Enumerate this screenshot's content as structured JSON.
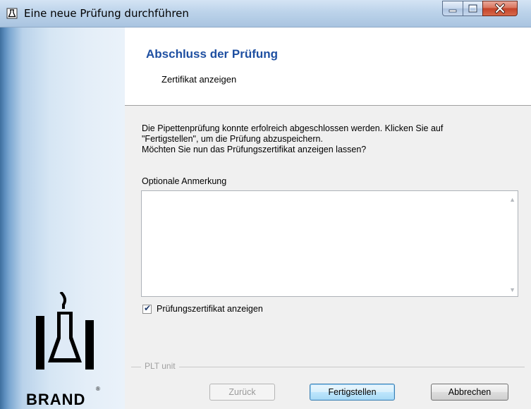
{
  "window": {
    "title": "Eine neue Prüfung durchführen"
  },
  "header": {
    "title": "Abschluss der Prüfung",
    "subtitle": "Zertifikat anzeigen"
  },
  "content": {
    "description_lines": [
      "Die Pipettenprüfung konnte erfolreich abgeschlossen werden. Klicken Sie auf",
      "\"Fertigstellen\", um die Prüfung abzuspeichern.",
      "Möchten Sie nun das Prüfungszertifikat anzeigen lassen?"
    ],
    "note_label": "Optionale Anmerkung",
    "note_value": "",
    "certificate_checkbox_label": "Prüfungszertifikat anzeigen",
    "certificate_checked": true
  },
  "footer": {
    "group_label": "PLT unit",
    "back_label": "Zurück",
    "finish_label": "Fertigstellen",
    "cancel_label": "Abbrechen"
  },
  "branding": {
    "logo_text": "BRAND",
    "registered_mark": "®"
  },
  "icons": {
    "window_icon": "flask-icon",
    "minimize": "minimize-icon",
    "maximize": "maximize-icon",
    "close": "close-icon"
  },
  "colors": {
    "header_title": "#1e4fa1",
    "sidebar_edge": "#3e6f9e",
    "close_button": "#c4432a"
  }
}
